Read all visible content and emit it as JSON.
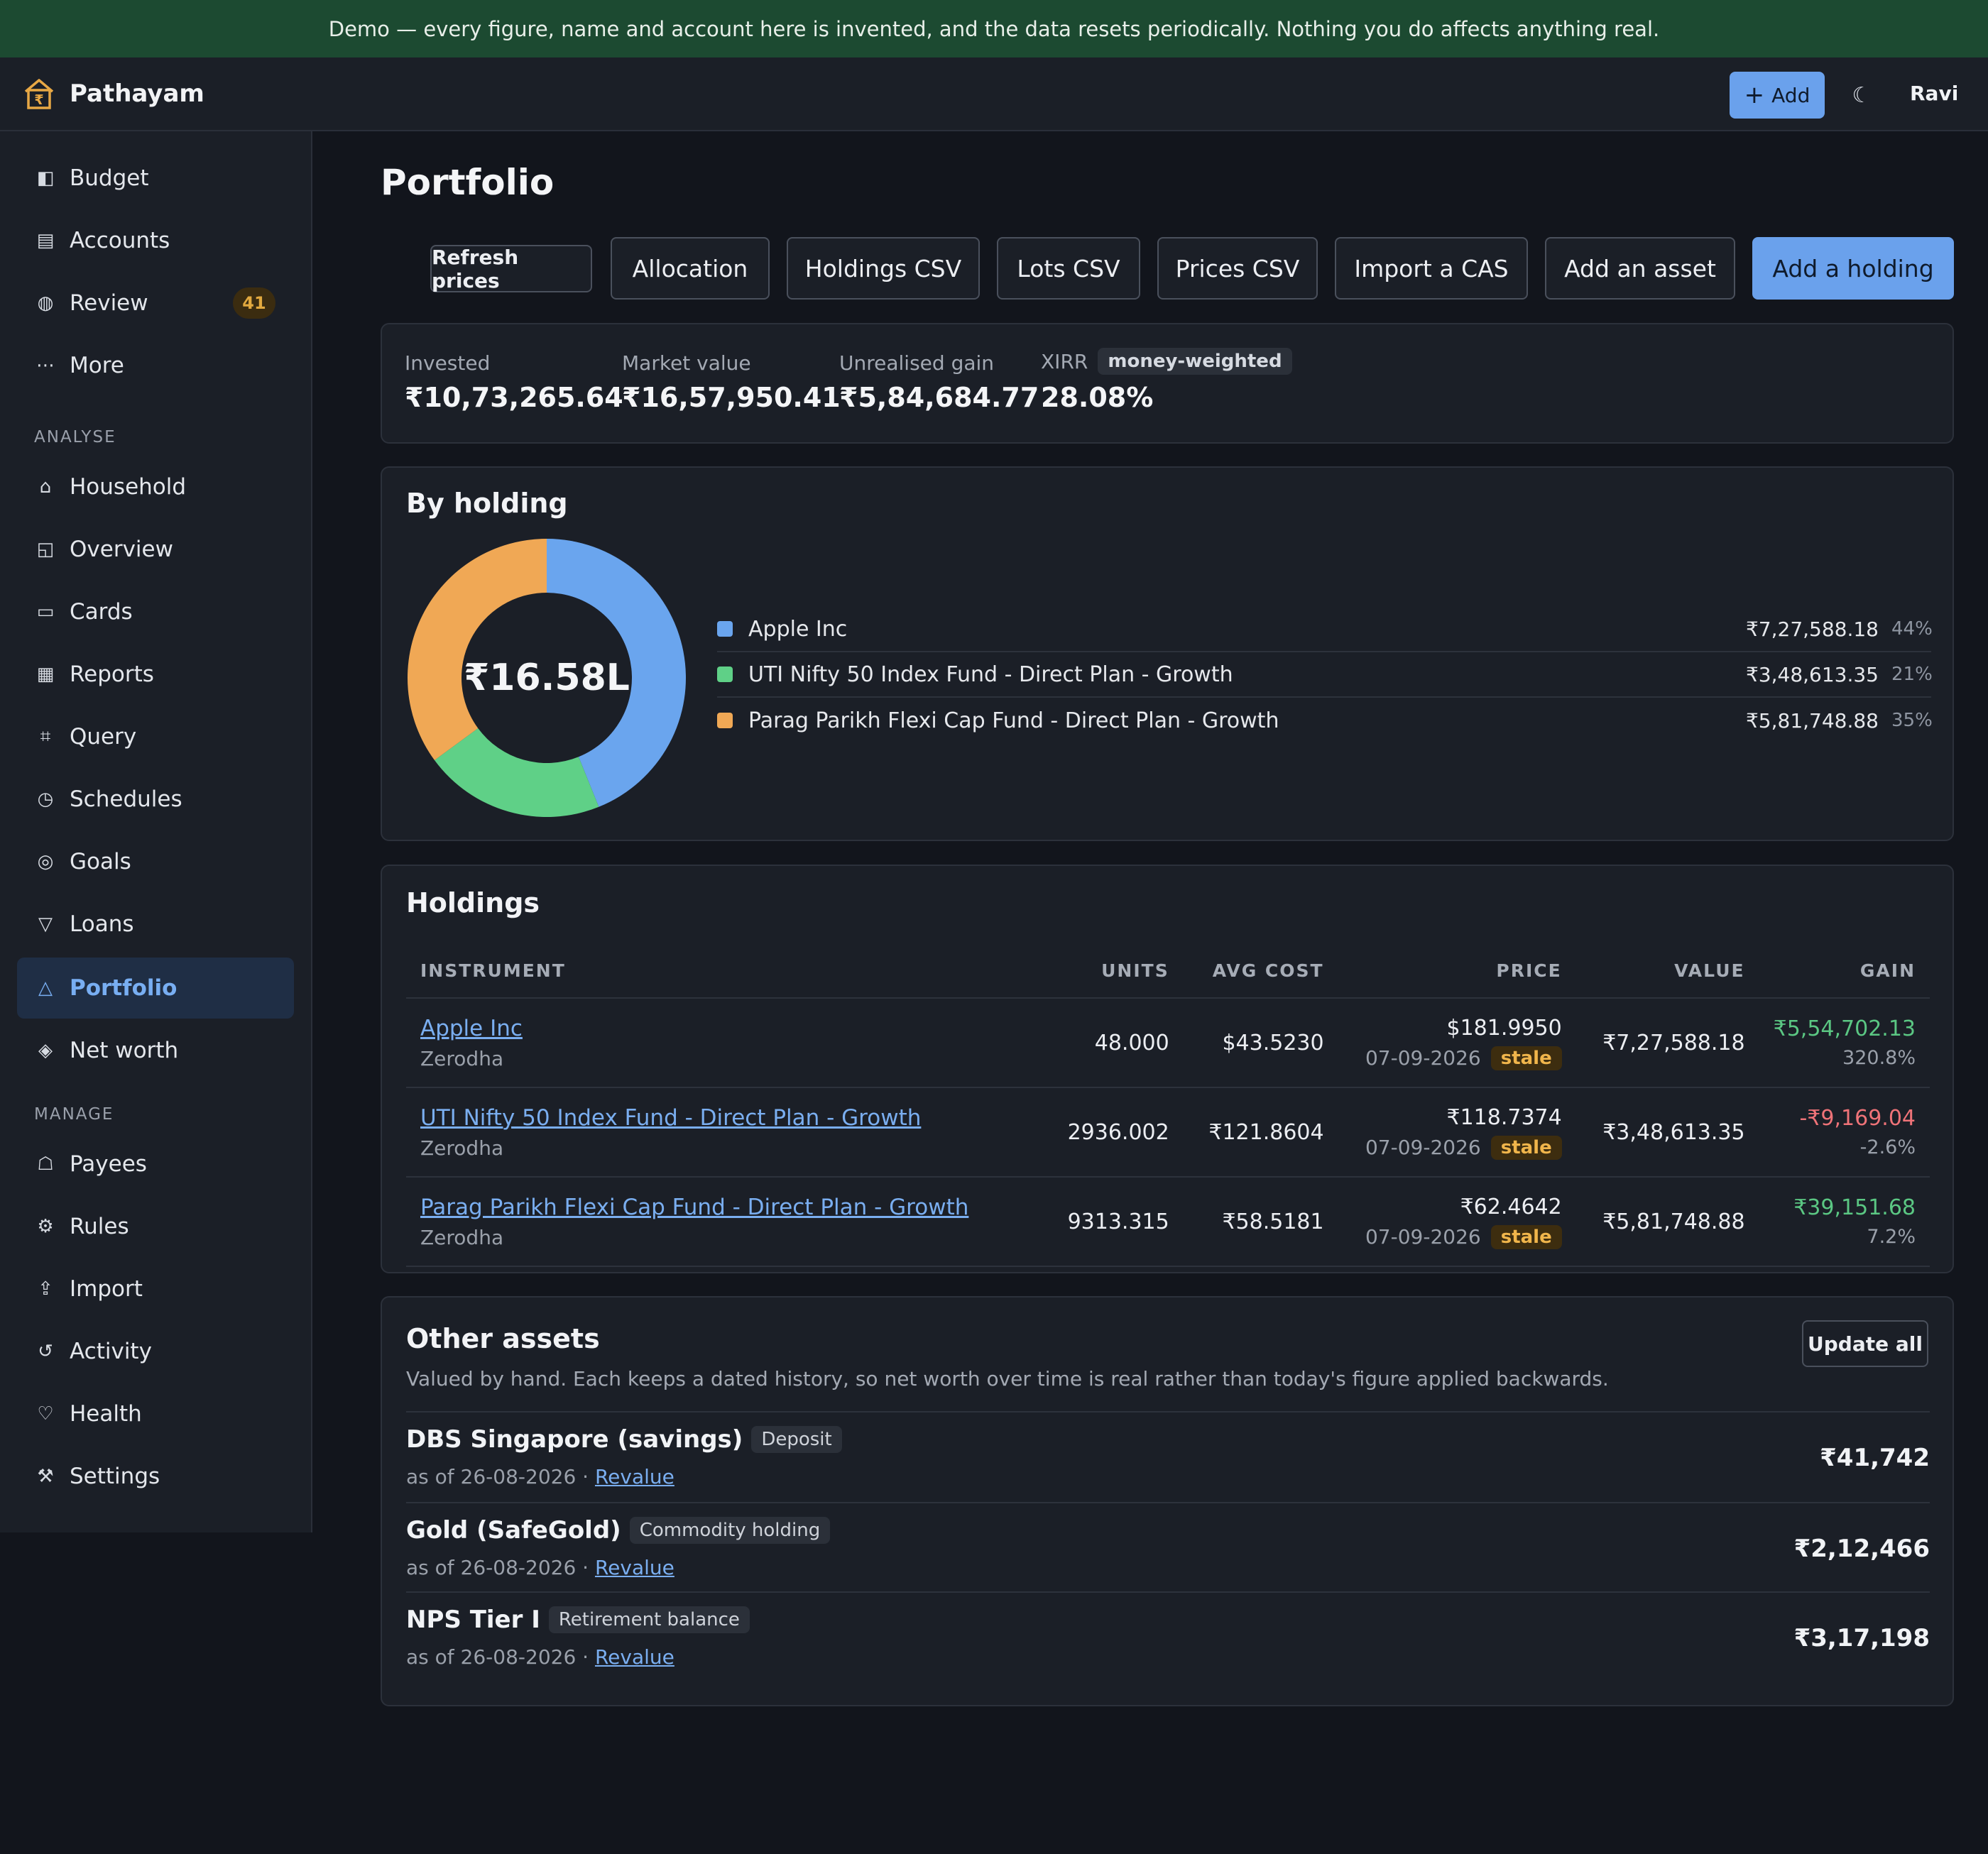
{
  "banner": "Demo — every figure, name and account here is invented, and the data resets periodically. Nothing you do affects anything real.",
  "brand": {
    "name": "Pathayam",
    "icon": "house-rupee-icon"
  },
  "topbar": {
    "add_label": "Add",
    "theme_icon": "☾",
    "user": "Ravi"
  },
  "sidebar": {
    "primary": [
      {
        "label": "Budget",
        "icon": "◧"
      },
      {
        "label": "Accounts",
        "icon": "▤"
      },
      {
        "label": "Review",
        "icon": "◍",
        "badge": "41"
      },
      {
        "label": "More",
        "icon": "⋯"
      }
    ],
    "analyse_heading": "ANALYSE",
    "analyse": [
      {
        "label": "Household",
        "icon": "⌂"
      },
      {
        "label": "Overview",
        "icon": "◱"
      },
      {
        "label": "Cards",
        "icon": "▭"
      },
      {
        "label": "Reports",
        "icon": "▦"
      },
      {
        "label": "Query",
        "icon": "⌗"
      },
      {
        "label": "Schedules",
        "icon": "◷"
      },
      {
        "label": "Goals",
        "icon": "◎"
      },
      {
        "label": "Loans",
        "icon": "▽"
      },
      {
        "label": "Portfolio",
        "icon": "△",
        "active": true
      },
      {
        "label": "Net worth",
        "icon": "◈"
      }
    ],
    "manage_heading": "MANAGE",
    "manage": [
      {
        "label": "Payees",
        "icon": "☖"
      },
      {
        "label": "Rules",
        "icon": "⚙"
      },
      {
        "label": "Import",
        "icon": "⇪"
      },
      {
        "label": "Activity",
        "icon": "↺"
      },
      {
        "label": "Health",
        "icon": "♡"
      },
      {
        "label": "Settings",
        "icon": "⚒"
      }
    ]
  },
  "page": {
    "title": "Portfolio"
  },
  "toolbar": {
    "refresh": "Refresh prices",
    "allocation": "Allocation",
    "holdings_csv": "Holdings CSV",
    "lots_csv": "Lots CSV",
    "prices_csv": "Prices CSV",
    "import_cas": "Import a CAS",
    "add_asset": "Add an asset",
    "add_holding": "Add a holding"
  },
  "summary": {
    "invested_label": "Invested",
    "invested": "₹10,73,265.64",
    "market_label": "Market value",
    "market": "₹16,57,950.41",
    "gain_label": "Unrealised gain",
    "gain": "₹5,84,684.77",
    "xirr_label": "XIRR",
    "xirr_pill": "money-weighted",
    "xirr": "28.08%"
  },
  "by_holding": {
    "title": "By holding",
    "center": "₹16.58L",
    "items": [
      {
        "name": "Apple Inc",
        "value": "₹7,27,588.18",
        "pct": "44%",
        "share": 0.4389,
        "color": "#6aa5ee"
      },
      {
        "name": "UTI Nifty 50 Index Fund - Direct Plan - Growth",
        "value": "₹3,48,613.35",
        "pct": "21%",
        "share": 0.2103,
        "color": "#5fd087"
      },
      {
        "name": "Parag Parikh Flexi Cap Fund - Direct Plan - Growth",
        "value": "₹5,81,748.88",
        "pct": "35%",
        "share": 0.3508,
        "color": "#f0a855"
      }
    ]
  },
  "holdings": {
    "title": "Holdings",
    "columns": [
      "INSTRUMENT",
      "UNITS",
      "AVG COST",
      "PRICE",
      "VALUE",
      "GAIN"
    ],
    "rows": [
      {
        "name": "Apple Inc",
        "broker": "Zerodha",
        "units": "48.000",
        "avg": "$43.5230",
        "price": "$181.9950",
        "price_date": "07-09-2026",
        "stale": "stale",
        "value": "₹7,27,588.18",
        "gain": "₹5,54,702.13",
        "gain_pct": "320.8%",
        "gain_dir": "pos"
      },
      {
        "name": "UTI Nifty 50 Index Fund - Direct Plan - Growth",
        "broker": "Zerodha",
        "units": "2936.002",
        "avg": "₹121.8604",
        "price": "₹118.7374",
        "price_date": "07-09-2026",
        "stale": "stale",
        "value": "₹3,48,613.35",
        "gain": "-₹9,169.04",
        "gain_pct": "-2.6%",
        "gain_dir": "neg"
      },
      {
        "name": "Parag Parikh Flexi Cap Fund - Direct Plan - Growth",
        "broker": "Zerodha",
        "units": "9313.315",
        "avg": "₹58.5181",
        "price": "₹62.4642",
        "price_date": "07-09-2026",
        "stale": "stale",
        "value": "₹5,81,748.88",
        "gain": "₹39,151.68",
        "gain_pct": "7.2%",
        "gain_dir": "pos"
      }
    ]
  },
  "other_assets": {
    "title": "Other assets",
    "subtitle": "Valued by hand. Each keeps a dated history, so net worth over time is real rather than today's figure applied backwards.",
    "update_all": "Update all",
    "revalue": "Revalue",
    "items": [
      {
        "name": "DBS Singapore (savings)",
        "type": "Deposit",
        "as_of": "as of 26-08-2026 · ",
        "value": "₹41,742"
      },
      {
        "name": "Gold (SafeGold)",
        "type": "Commodity holding",
        "as_of": "as of 26-08-2026 · ",
        "value": "₹2,12,466"
      },
      {
        "name": "NPS Tier I",
        "type": "Retirement balance",
        "as_of": "as of 26-08-2026 · ",
        "value": "₹3,17,198"
      }
    ]
  }
}
